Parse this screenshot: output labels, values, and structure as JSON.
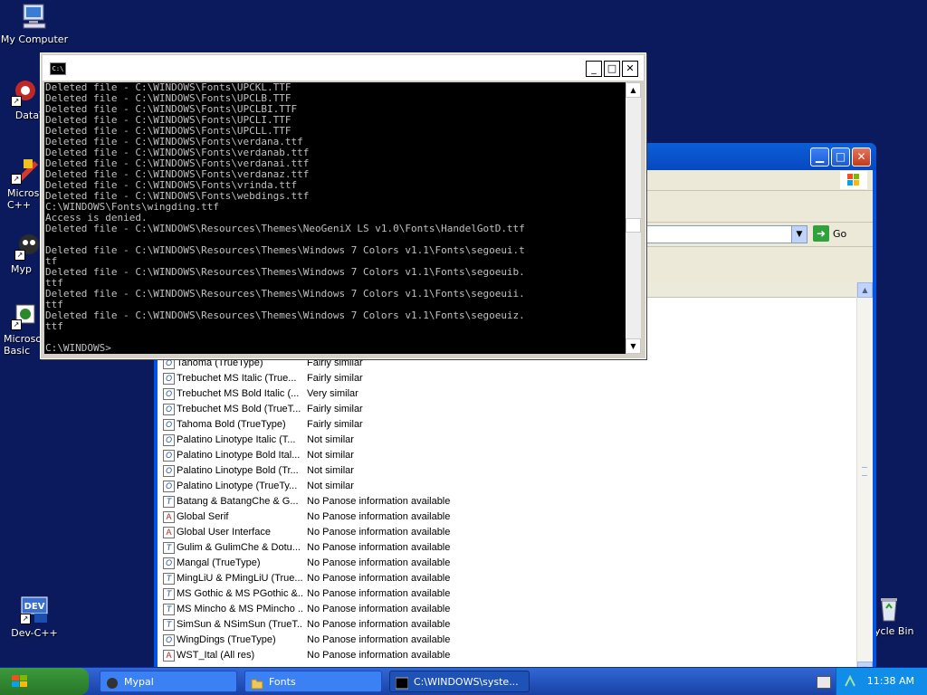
{
  "desktop": {
    "icons": [
      {
        "label": "My Computer"
      },
      {
        "label": "DataWa"
      },
      {
        "label": "Microsoft C++"
      },
      {
        "label": "Myp"
      },
      {
        "label": "Microsoft Basic"
      },
      {
        "label": "Dev-C++"
      },
      {
        "label": "cycle Bin"
      }
    ]
  },
  "console": {
    "icon_text": "C:\\",
    "lines": [
      "Deleted file - C:\\WINDOWS\\Fonts\\UPCKL.TTF",
      "Deleted file - C:\\WINDOWS\\Fonts\\UPCLB.TTF",
      "Deleted file - C:\\WINDOWS\\Fonts\\UPCLBI.TTF",
      "Deleted file - C:\\WINDOWS\\Fonts\\UPCLI.TTF",
      "Deleted file - C:\\WINDOWS\\Fonts\\UPCLL.TTF",
      "Deleted file - C:\\WINDOWS\\Fonts\\verdana.ttf",
      "Deleted file - C:\\WINDOWS\\Fonts\\verdanab.ttf",
      "Deleted file - C:\\WINDOWS\\Fonts\\verdanai.ttf",
      "Deleted file - C:\\WINDOWS\\Fonts\\verdanaz.ttf",
      "Deleted file - C:\\WINDOWS\\Fonts\\vrinda.ttf",
      "Deleted file - C:\\WINDOWS\\Fonts\\webdings.ttf",
      "C:\\WINDOWS\\Fonts\\wingding.ttf",
      "Access is denied.",
      "Deleted file - C:\\WINDOWS\\Resources\\Themes\\NeoGeniX LS v1.0\\Fonts\\HandelGotD.ttf",
      "",
      "Deleted file - C:\\WINDOWS\\Resources\\Themes\\Windows 7 Colors v1.1\\Fonts\\segoeui.t",
      "tf",
      "Deleted file - C:\\WINDOWS\\Resources\\Themes\\Windows 7 Colors v1.1\\Fonts\\segoeuib.",
      "ttf",
      "Deleted file - C:\\WINDOWS\\Resources\\Themes\\Windows 7 Colors v1.1\\Fonts\\segoeuii.",
      "ttf",
      "Deleted file - C:\\WINDOWS\\Resources\\Themes\\Windows 7 Colors v1.1\\Fonts\\segoeuiz.",
      "ttf",
      "",
      "C:\\WINDOWS>"
    ]
  },
  "fonts_window": {
    "go_label": "Go",
    "rows": [
      {
        "icon": "O",
        "name": "Tahoma (TrueType)",
        "similarity": "Fairly similar"
      },
      {
        "icon": "O",
        "name": "Trebuchet MS Italic (True...",
        "similarity": "Fairly similar"
      },
      {
        "icon": "O",
        "name": "Trebuchet MS Bold Italic (...",
        "similarity": "Very similar"
      },
      {
        "icon": "O",
        "name": "Trebuchet MS Bold (TrueT...",
        "similarity": "Fairly similar"
      },
      {
        "icon": "O",
        "name": "Tahoma Bold (TrueType)",
        "similarity": "Fairly similar"
      },
      {
        "icon": "O",
        "name": "Palatino Linotype Italic (T...",
        "similarity": "Not similar"
      },
      {
        "icon": "O",
        "name": "Palatino Linotype Bold Ital...",
        "similarity": "Not similar"
      },
      {
        "icon": "O",
        "name": "Palatino Linotype Bold (Tr...",
        "similarity": "Not similar"
      },
      {
        "icon": "O",
        "name": "Palatino Linotype (TrueTy...",
        "similarity": "Not similar"
      },
      {
        "icon": "T",
        "name": "Batang & BatangChe & G...",
        "similarity": "No Panose information available"
      },
      {
        "icon": "A",
        "name": "Global Serif",
        "similarity": "No Panose information available"
      },
      {
        "icon": "A",
        "name": "Global User Interface",
        "similarity": "No Panose information available"
      },
      {
        "icon": "T",
        "name": "Gulim & GulimChe & Dotu...",
        "similarity": "No Panose information available"
      },
      {
        "icon": "O",
        "name": "Mangal (TrueType)",
        "similarity": "No Panose information available"
      },
      {
        "icon": "T",
        "name": "MingLiU & PMingLiU (True...",
        "similarity": "No Panose information available"
      },
      {
        "icon": "T",
        "name": "MS Gothic & MS PGothic &...",
        "similarity": "No Panose information available"
      },
      {
        "icon": "T",
        "name": "MS Mincho & MS PMincho ...",
        "similarity": "No Panose information available"
      },
      {
        "icon": "T",
        "name": "SimSun & NSimSun (TrueT...",
        "similarity": "No Panose information available"
      },
      {
        "icon": "O",
        "name": "WingDings (TrueType)",
        "similarity": "No Panose information available"
      },
      {
        "icon": "A",
        "name": "WST_Ital (All res)",
        "similarity": "No Panose information available"
      }
    ]
  },
  "taskbar": {
    "tasks": [
      {
        "label": "Mypal"
      },
      {
        "label": "Fonts"
      },
      {
        "label": "C:\\WINDOWS\\syste..."
      }
    ],
    "clock": "11:38 AM"
  },
  "colors": {
    "desktop_bg": "#0a1a5c",
    "xp_blue": "#0054e3",
    "start_green": "#3c9a3c"
  }
}
